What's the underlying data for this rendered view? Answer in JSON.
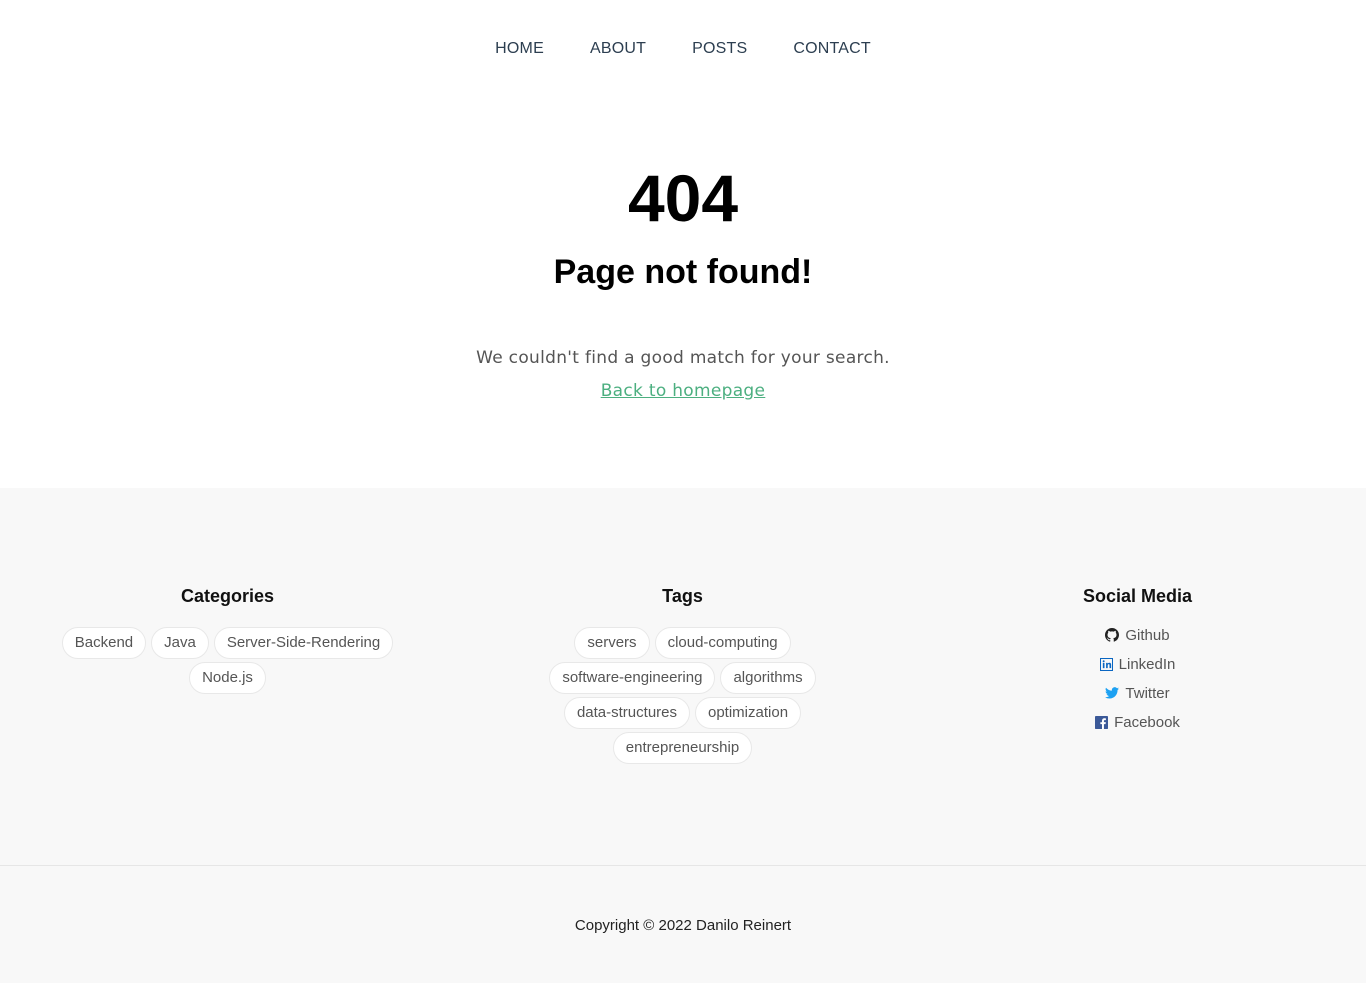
{
  "nav": {
    "items": [
      {
        "label": "HOME"
      },
      {
        "label": "ABOUT"
      },
      {
        "label": "POSTS"
      },
      {
        "label": "CONTACT"
      }
    ]
  },
  "hero": {
    "code": "404",
    "title": "Page not found!",
    "message": "We couldn't find a good match for your search.",
    "link_label": "Back to homepage"
  },
  "footer": {
    "categories": {
      "title": "Categories",
      "items": [
        "Backend",
        "Java",
        "Server-Side-Rendering",
        "Node.js"
      ]
    },
    "tags": {
      "title": "Tags",
      "items": [
        "servers",
        "cloud-computing",
        "software-engineering",
        "algorithms",
        "data-structures",
        "optimization",
        "entrepreneurship"
      ]
    },
    "social": {
      "title": "Social Media",
      "items": [
        {
          "label": "Github",
          "icon": "github-icon",
          "color": "#222222"
        },
        {
          "label": "LinkedIn",
          "icon": "linkedin-icon",
          "color": "#0a66c2"
        },
        {
          "label": "Twitter",
          "icon": "twitter-icon",
          "color": "#1da1f2"
        },
        {
          "label": "Facebook",
          "icon": "facebook-icon",
          "color": "#3b5998"
        }
      ]
    },
    "copyright": "Copyright © 2022 Danilo Reinert"
  },
  "colors": {
    "link": "#4caf80",
    "footer_bg": "#f8f8f8",
    "nav_text": "#2c3e50"
  }
}
